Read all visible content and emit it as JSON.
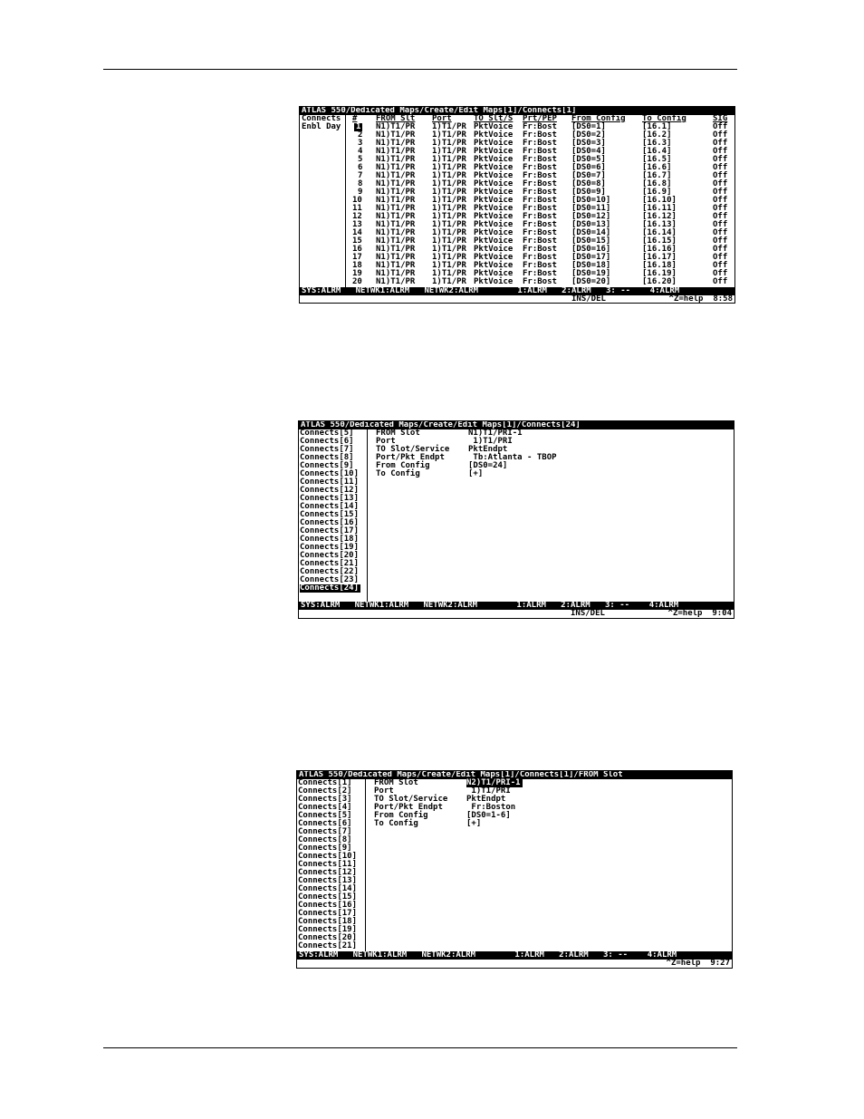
{
  "screen1": {
    "title": "ATLAS 550/Dedicated Maps/Create/Edit Maps[1]/Connects[1]",
    "left_labels": [
      "Connects",
      "Enbl Day"
    ],
    "headers": [
      "#",
      "FROM Slt",
      "Port",
      "TO Slt/S",
      "Prt/PEP",
      "From Config",
      "To Config",
      "SIG"
    ],
    "rows": [
      [
        "1",
        "N1)T1/PR",
        "1)T1/PR",
        "PktVoice",
        "Fr:Bost",
        "[DS0=1]",
        "[16.1]",
        "Off"
      ],
      [
        "2",
        "N1)T1/PR",
        "1)T1/PR",
        "PktVoice",
        "Fr:Bost",
        "[DS0=2]",
        "[16.2]",
        "Off"
      ],
      [
        "3",
        "N1)T1/PR",
        "1)T1/PR",
        "PktVoice",
        "Fr:Bost",
        "[DS0=3]",
        "[16.3]",
        "Off"
      ],
      [
        "4",
        "N1)T1/PR",
        "1)T1/PR",
        "PktVoice",
        "Fr:Bost",
        "[DS0=4]",
        "[16.4]",
        "Off"
      ],
      [
        "5",
        "N1)T1/PR",
        "1)T1/PR",
        "PktVoice",
        "Fr:Bost",
        "[DS0=5]",
        "[16.5]",
        "Off"
      ],
      [
        "6",
        "N1)T1/PR",
        "1)T1/PR",
        "PktVoice",
        "Fr:Bost",
        "[DS0=6]",
        "[16.6]",
        "Off"
      ],
      [
        "7",
        "N1)T1/PR",
        "1)T1/PR",
        "PktVoice",
        "Fr:Bost",
        "[DS0=7]",
        "[16.7]",
        "Off"
      ],
      [
        "8",
        "N1)T1/PR",
        "1)T1/PR",
        "PktVoice",
        "Fr:Bost",
        "[DS0=8]",
        "[16.8]",
        "Off"
      ],
      [
        "9",
        "N1)T1/PR",
        "1)T1/PR",
        "PktVoice",
        "Fr:Bost",
        "[DS0=9]",
        "[16.9]",
        "Off"
      ],
      [
        "10",
        "N1)T1/PR",
        "1)T1/PR",
        "PktVoice",
        "Fr:Bost",
        "[DS0=10]",
        "[16.10]",
        "Off"
      ],
      [
        "11",
        "N1)T1/PR",
        "1)T1/PR",
        "PktVoice",
        "Fr:Bost",
        "[DS0=11]",
        "[16.11]",
        "Off"
      ],
      [
        "12",
        "N1)T1/PR",
        "1)T1/PR",
        "PktVoice",
        "Fr:Bost",
        "[DS0=12]",
        "[16.12]",
        "Off"
      ],
      [
        "13",
        "N1)T1/PR",
        "1)T1/PR",
        "PktVoice",
        "Fr:Bost",
        "[DS0=13]",
        "[16.13]",
        "Off"
      ],
      [
        "14",
        "N1)T1/PR",
        "1)T1/PR",
        "PktVoice",
        "Fr:Bost",
        "[DS0=14]",
        "[16.14]",
        "Off"
      ],
      [
        "15",
        "N1)T1/PR",
        "1)T1/PR",
        "PktVoice",
        "Fr:Bost",
        "[DS0=15]",
        "[16.15]",
        "Off"
      ],
      [
        "16",
        "N1)T1/PR",
        "1)T1/PR",
        "PktVoice",
        "Fr:Bost",
        "[DS0=16]",
        "[16.16]",
        "Off"
      ],
      [
        "17",
        "N1)T1/PR",
        "1)T1/PR",
        "PktVoice",
        "Fr:Bost",
        "[DS0=17]",
        "[16.17]",
        "Off"
      ],
      [
        "18",
        "N1)T1/PR",
        "1)T1/PR",
        "PktVoice",
        "Fr:Bost",
        "[DS0=18]",
        "[16.18]",
        "Off"
      ],
      [
        "19",
        "N1)T1/PR",
        "1)T1/PR",
        "PktVoice",
        "Fr:Bost",
        "[DS0=19]",
        "[16.19]",
        "Off"
      ],
      [
        "20",
        "N1)T1/PR",
        "1)T1/PR",
        "PktVoice",
        "Fr:Bost",
        "[DS0=20]",
        "[16.20]",
        "Off"
      ]
    ],
    "status": "SYS:ALRM   NETWK1:ALRM   NETWK2:ALRM        1:ALRM   2:ALRM   3: --    4:ALRM",
    "footer_left": "INS/DEL",
    "footer_right": "^Z=help  8:58"
  },
  "screen2": {
    "title": "ATLAS 550/Dedicated Maps/Create/Edit Maps[1]/Connects[24]",
    "list": [
      "Connects[5]",
      "Connects[6]",
      "Connects[7]",
      "Connects[8]",
      "Connects[9]",
      "Connects[10]",
      "Connects[11]",
      "Connects[12]",
      "Connects[13]",
      "Connects[14]",
      "Connects[15]",
      "Connects[16]",
      "Connects[17]",
      "Connects[18]",
      "Connects[19]",
      "Connects[20]",
      "Connects[21]",
      "Connects[22]",
      "Connects[23]",
      "Connects[24]"
    ],
    "fields": [
      [
        "FROM Slot",
        "N1)T1/PRI-1"
      ],
      [
        "Port",
        " 1)T1/PRI"
      ],
      [
        "TO Slot/Service",
        "PktEndpt"
      ],
      [
        "Port/Pkt Endpt",
        " Tb:Atlanta - TBOP"
      ],
      [
        "From Config",
        "[DS0=24]"
      ],
      [
        "To Config",
        "[+]"
      ]
    ],
    "status": "SYS:ALRM   NETWK1:ALRM   NETWK2:ALRM        1:ALRM   2:ALRM   3: --    4:ALRM",
    "footer_left": "INS/DEL",
    "footer_right": "^Z=help  9:04"
  },
  "screen3": {
    "title": "ATLAS 550/Dedicated Maps/Create/Edit Maps[1]/Connects[1]/FROM Slot",
    "list": [
      "Connects[1]",
      "Connects[2]",
      "Connects[3]",
      "Connects[4]",
      "Connects[5]",
      "Connects[6]",
      "Connects[7]",
      "Connects[8]",
      "Connects[9]",
      "Connects[10]",
      "Connects[11]",
      "Connects[12]",
      "Connects[13]",
      "Connects[14]",
      "Connects[15]",
      "Connects[16]",
      "Connects[17]",
      "Connects[18]",
      "Connects[19]",
      "Connects[20]",
      "Connects[21]"
    ],
    "fields": [
      [
        "FROM Slot",
        "N2)T1/PRI-1"
      ],
      [
        "Port",
        " 1)T1/PRI"
      ],
      [
        "TO Slot/Service",
        "PktEndpt"
      ],
      [
        "Port/Pkt Endpt",
        " Fr:Boston"
      ],
      [
        "From Config",
        "[DS0=1-6]"
      ],
      [
        "To Config",
        "[+]"
      ]
    ],
    "status": "SYS:ALRM   NETWK1:ALRM   NETWK2:ALRM        1:ALRM   2:ALRM   3: --    4:ALRM",
    "footer_right": "^Z=help  9:27"
  }
}
